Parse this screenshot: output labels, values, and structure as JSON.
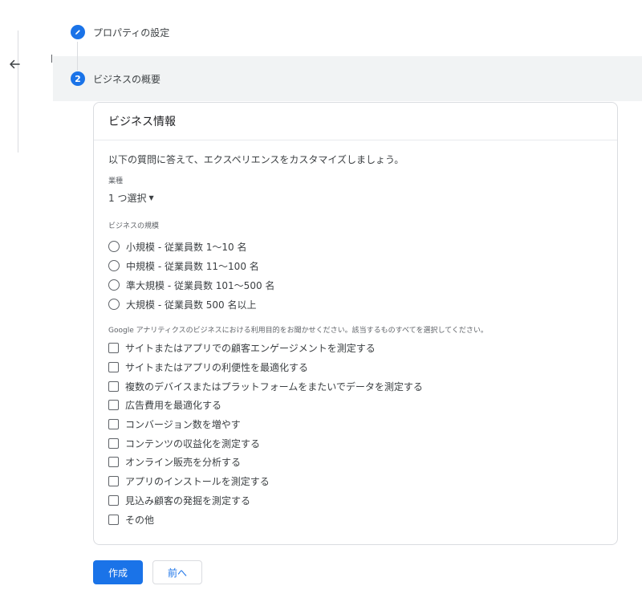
{
  "stepper": {
    "step1": {
      "icon": "pencil-icon",
      "label": "プロパティの設定"
    },
    "step2": {
      "number": "2",
      "label": "ビジネスの概要"
    }
  },
  "colors": {
    "accent": "#1a73e8",
    "active_step_background": "#f1f3f4",
    "text": "#202124"
  },
  "card": {
    "title": "ビジネス情報",
    "intro": "以下の質問に答えて、エクスペリエンスをカスタマイズしましょう。",
    "industry": {
      "label": "業種",
      "value": "1 つ選択"
    },
    "size": {
      "label": "ビジネスの規模",
      "options": [
        "小規模 - 従業員数 1～10 名",
        "中規模 - 従業員数 11～100 名",
        "準大規模 - 従業員数 101～500 名",
        "大規模 - 従業員数 500 名以上"
      ]
    },
    "purpose": {
      "label": "Google アナリティクスのビジネスにおける利用目的をお聞かせください。該当するものすべてを選択してください。",
      "options": [
        "サイトまたはアプリでの顧客エンゲージメントを測定する",
        "サイトまたはアプリの利便性を最適化する",
        "複数のデバイスまたはプラットフォームをまたいでデータを測定する",
        "広告費用を最適化する",
        "コンバージョン数を増やす",
        "コンテンツの収益化を測定する",
        "オンライン販売を分析する",
        "アプリのインストールを測定する",
        "見込み顧客の発掘を測定する",
        "その他"
      ]
    }
  },
  "buttons": {
    "create": "作成",
    "previous": "前へ"
  }
}
